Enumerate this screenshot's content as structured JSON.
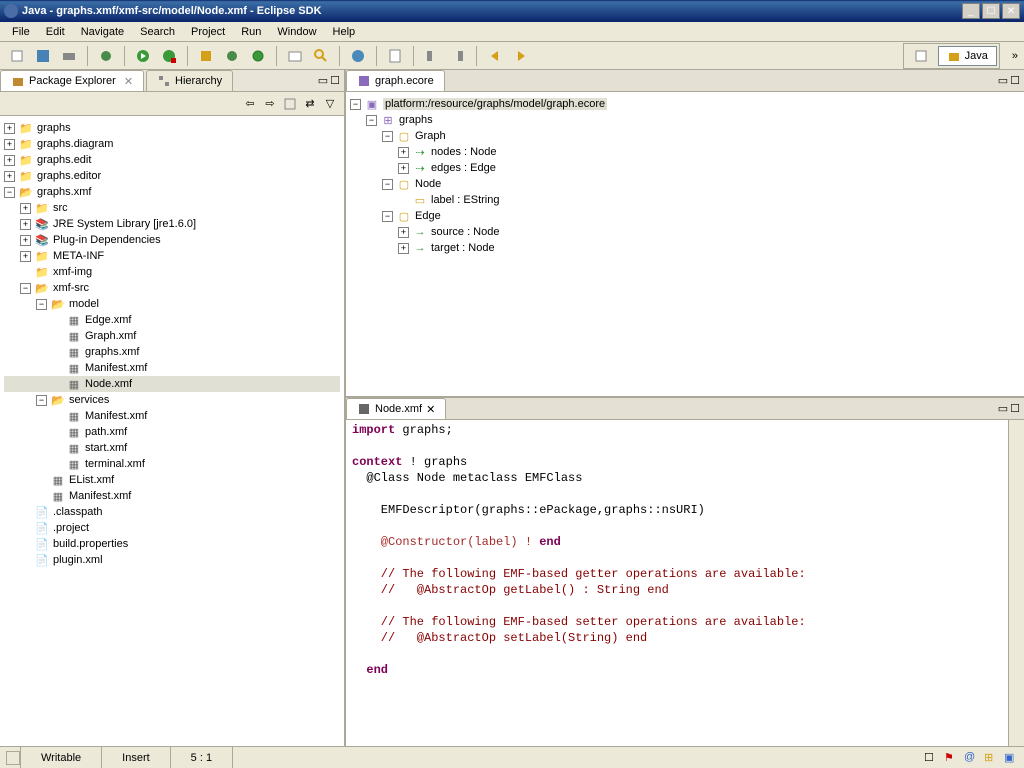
{
  "title": "Java - graphs.xmf/xmf-src/model/Node.xmf - Eclipse SDK",
  "menubar": [
    "File",
    "Edit",
    "Navigate",
    "Search",
    "Project",
    "Run",
    "Window",
    "Help"
  ],
  "perspective": {
    "active": "Java"
  },
  "package_explorer": {
    "tab_label": "Package Explorer",
    "other_tab": "Hierarchy",
    "tree": {
      "graphs": "graphs",
      "graphs_diagram": "graphs.diagram",
      "graphs_edit": "graphs.edit",
      "graphs_editor": "graphs.editor",
      "graphs_xmf": "graphs.xmf",
      "src": "src",
      "jre": "JRE System Library [jre1.6.0]",
      "plugin_deps": "Plug-in Dependencies",
      "meta_inf": "META-INF",
      "xmf_img": "xmf-img",
      "xmf_src": "xmf-src",
      "model": "model",
      "edge_xmf": "Edge.xmf",
      "graph_xmf": "Graph.xmf",
      "graphs_xmf_file": "graphs.xmf",
      "manifest_xmf": "Manifest.xmf",
      "node_xmf": "Node.xmf",
      "services": "services",
      "svc_manifest": "Manifest.xmf",
      "svc_path": "path.xmf",
      "svc_start": "start.xmf",
      "svc_terminal": "terminal.xmf",
      "elist_xmf": "EList.xmf",
      "manifest_xmf2": "Manifest.xmf",
      "classpath": ".classpath",
      "project": ".project",
      "build_props": "build.properties",
      "plugin_xml": "plugin.xml"
    }
  },
  "ecore_editor": {
    "tab_label": "graph.ecore",
    "root": "platform:/resource/graphs/model/graph.ecore",
    "pkg": "graphs",
    "class_graph": "Graph",
    "graph_nodes": "nodes : Node",
    "graph_edges": "edges : Edge",
    "class_node": "Node",
    "node_label": "label : EString",
    "class_edge": "Edge",
    "edge_source": "source : Node",
    "edge_target": "target : Node"
  },
  "code_editor": {
    "tab_label": "Node.xmf",
    "line1_a": "import",
    "line1_b": " graphs;",
    "line2": "",
    "line3_a": "context",
    "line3_b": " ! graphs",
    "line4": "  @Class Node metaclass EMFClass",
    "line5": "",
    "line6": "    EMFDescriptor(graphs::ePackage,graphs::nsURI)",
    "line7": "",
    "line8a": "    @Constructor(label) !",
    "line8b": " end",
    "line9": "",
    "line10": "    // The following EMF-based getter operations are available:",
    "line11": "    //   @AbstractOp getLabel() : String end",
    "line12": "",
    "line13": "    // The following EMF-based setter operations are available:",
    "line14": "    //   @AbstractOp setLabel(String) end",
    "line15": "",
    "line16": "  end"
  },
  "statusbar": {
    "writable": "Writable",
    "insert": "Insert",
    "pos": "5 : 1"
  }
}
